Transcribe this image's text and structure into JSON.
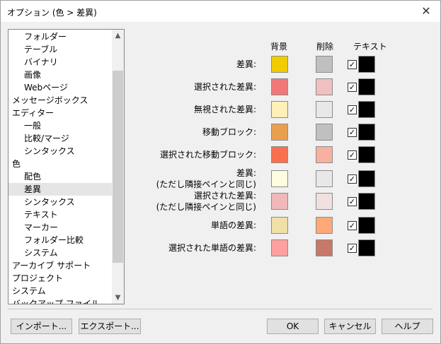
{
  "window": {
    "title": "オプション (色 > 差異)"
  },
  "tree": {
    "items": [
      {
        "label": "フォルダー",
        "indent": 1
      },
      {
        "label": "テーブル",
        "indent": 1
      },
      {
        "label": "バイナリ",
        "indent": 1
      },
      {
        "label": "画像",
        "indent": 1
      },
      {
        "label": "Webページ",
        "indent": 1
      },
      {
        "label": "メッセージボックス",
        "indent": 0
      },
      {
        "label": "エディター",
        "indent": 0
      },
      {
        "label": "一般",
        "indent": 1
      },
      {
        "label": "比較/マージ",
        "indent": 1
      },
      {
        "label": "シンタックス",
        "indent": 1
      },
      {
        "label": "色",
        "indent": 0
      },
      {
        "label": "配色",
        "indent": 1
      },
      {
        "label": "差異",
        "indent": 1,
        "selected": true
      },
      {
        "label": "シンタックス",
        "indent": 1
      },
      {
        "label": "テキスト",
        "indent": 1
      },
      {
        "label": "マーカー",
        "indent": 1
      },
      {
        "label": "フォルダー比較",
        "indent": 1
      },
      {
        "label": "システム",
        "indent": 1
      },
      {
        "label": "アーカイブ サポート",
        "indent": 0
      },
      {
        "label": "プロジェクト",
        "indent": 0
      },
      {
        "label": "システム",
        "indent": 0
      },
      {
        "label": "バックアップ ファイル",
        "indent": 0
      }
    ]
  },
  "columns": {
    "background": "背景",
    "deleted": "削除",
    "text": "テキスト"
  },
  "rows": [
    {
      "label": "差異:",
      "bg": "#f0cc00",
      "del": "#c0c0c0",
      "checked": true
    },
    {
      "label": "選択された差異:",
      "bg": "#f07878",
      "del": "#f0c0c0",
      "checked": true
    },
    {
      "label": "無視された差異:",
      "bg": "#fff0b8",
      "del": "#e8e8e8",
      "checked": true
    },
    {
      "label": "移動ブロック:",
      "bg": "#e8a050",
      "del": "#c0c0c0",
      "checked": true
    },
    {
      "label": "選択された移動ブロック:",
      "bg": "#f87050",
      "del": "#f8b0a0",
      "checked": true
    },
    {
      "label": "差異:\n(ただし隣接ペインと同じ)",
      "bg": "#fffce0",
      "del": "#e8e8e8",
      "checked": true
    },
    {
      "label": "選択された差異:\n(ただし隣接ペインと同じ)",
      "bg": "#f0b8b8",
      "del": "#f0e0e0",
      "checked": true
    },
    {
      "label": "単語の差異:",
      "bg": "#f0e0a8",
      "del": "#ffa878",
      "checked": true
    },
    {
      "label": "選択された単語の差異:",
      "bg": "#ffa0a0",
      "del": "#c87868",
      "checked": true
    }
  ],
  "buttons": {
    "import": "インポート...",
    "export": "エクスポート...",
    "ok": "OK",
    "cancel": "キャンセル",
    "help": "ヘルプ"
  },
  "icons": {
    "close": "close-icon",
    "scroll_up": "chevron-up-icon",
    "scroll_down": "chevron-down-icon",
    "check": "check-icon"
  }
}
